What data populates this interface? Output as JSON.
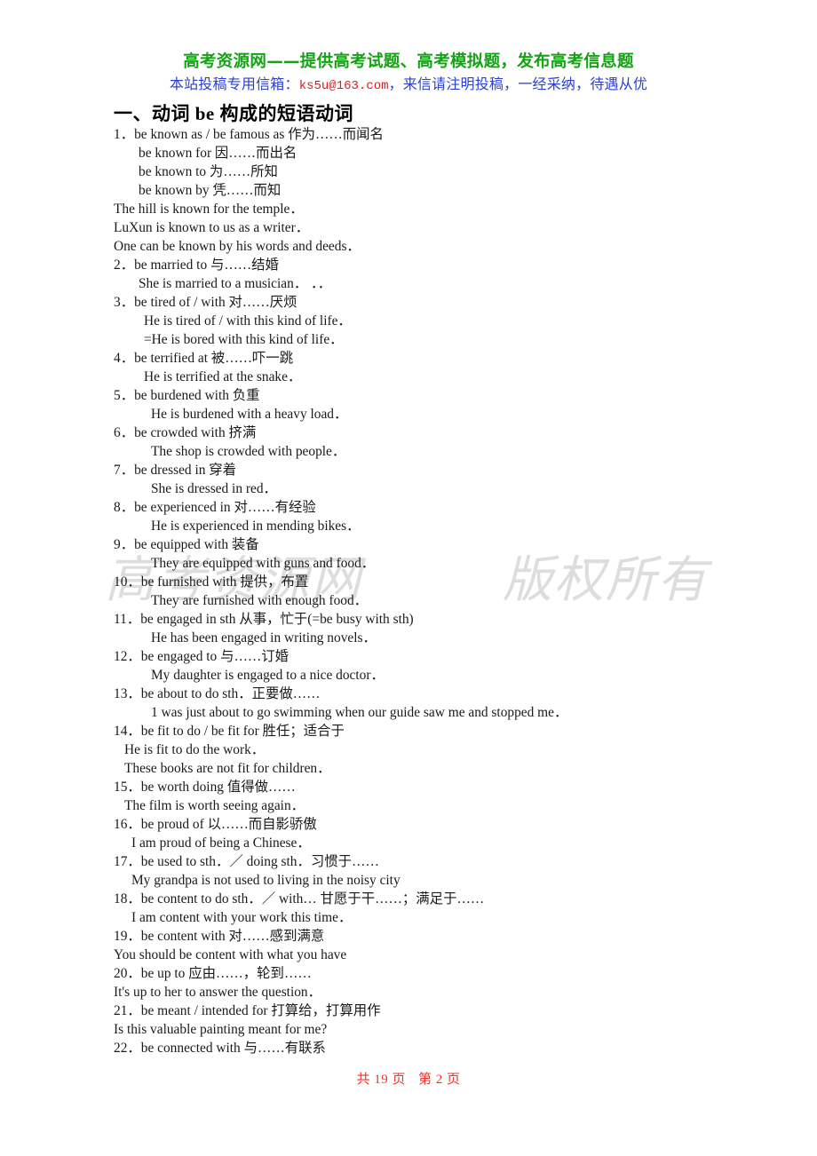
{
  "banner": {
    "title": "高考资源网——提供高考试题、高考模拟题，发布高考信息题",
    "sub_prefix": "本站投稿专用信箱：",
    "email": "ks5u@163.com",
    "sub_suffix": "，来信请注明投稿，一经采纳，待遇从优"
  },
  "heading": "一、动词 be 构成的短语动词",
  "watermark": {
    "left": "高考资源网",
    "right": "版权所有"
  },
  "lines": [
    {
      "indent": "i0",
      "text": "1．be known as / be famous as 作为……而闻名"
    },
    {
      "indent": "i3",
      "text": "be known for 因……而出名"
    },
    {
      "indent": "i3",
      "text": "be known to 为……所知"
    },
    {
      "indent": "i3",
      "text": "be known by 凭……而知"
    },
    {
      "indent": "i0",
      "text": "The hill is known for the temple．"
    },
    {
      "indent": "i0",
      "text": "LuXun is known to us as a writer．"
    },
    {
      "indent": "i0",
      "text": "One can be known by his words and deeds．"
    },
    {
      "indent": "i0",
      "text": "2．be married to 与……结婚"
    },
    {
      "indent": "i3",
      "text": "She is married to a musician．            ．．"
    },
    {
      "indent": "i0",
      "text": "3．be tired of / with 对……厌烦"
    },
    {
      "indent": "i4",
      "text": "He is tired of / with this kind of life．"
    },
    {
      "indent": "i4",
      "text": "=He is bored with this kind of life．"
    },
    {
      "indent": "i0",
      "text": "4．be terrified at 被……吓一跳"
    },
    {
      "indent": "i4",
      "text": "He is terrified at the snake．"
    },
    {
      "indent": "i0",
      "text": "5．be burdened with 负重"
    },
    {
      "indent": "i5",
      "text": "He is burdened with a heavy load．"
    },
    {
      "indent": "i0",
      "text": "6．be crowded with 挤满"
    },
    {
      "indent": "i5",
      "text": "The shop is crowded with people．"
    },
    {
      "indent": "i0",
      "text": "7．be dressed in 穿着"
    },
    {
      "indent": "i5",
      "text": "She is dressed in red．"
    },
    {
      "indent": "i0",
      "text": "8．be experienced in 对……有经验"
    },
    {
      "indent": "i5",
      "text": "He is experienced in mending bikes．"
    },
    {
      "indent": "i0",
      "text": "9．be equipped with 装备"
    },
    {
      "indent": "i5",
      "text": "They are equipped with guns and food．"
    },
    {
      "indent": "i0",
      "text": "10．be furnished with 提供，布置"
    },
    {
      "indent": "i5",
      "text": "They are furnished with enough food．"
    },
    {
      "indent": "i0",
      "text": "11．be engaged in sth 从事，忙于(=be busy with sth)"
    },
    {
      "indent": "i5",
      "text": "He has been engaged in writing novels．"
    },
    {
      "indent": "i0",
      "text": "12．be engaged to 与……订婚"
    },
    {
      "indent": "i5",
      "text": "My daughter is engaged to a nice doctor．"
    },
    {
      "indent": "i0",
      "text": "13．be about to do sth．正要做……"
    },
    {
      "indent": "i5",
      "text": "1 was just about to go swimming when our guide saw me and stopped me．"
    },
    {
      "indent": "i0",
      "text": "14．be fit to do / be fit for 胜任；适合于"
    },
    {
      "indent": "i1",
      "text": "He is fit to do the work．"
    },
    {
      "indent": "i1",
      "text": "These books are not fit for children．"
    },
    {
      "indent": "i0",
      "text": "15．be worth doing 值得做……"
    },
    {
      "indent": "i1",
      "text": "The film is worth seeing again．"
    },
    {
      "indent": "i0",
      "text": "16．be proud of 以……而自影骄傲"
    },
    {
      "indent": "i2",
      "text": "I am proud of being a Chinese．"
    },
    {
      "indent": "i0",
      "text": "17．be used to sth．／ doing sth．习惯于……"
    },
    {
      "indent": "i2",
      "text": "My grandpa is not used to living in the noisy city"
    },
    {
      "indent": "i0",
      "text": "18．be content to do sth．／ with… 甘愿于干……；满足于……"
    },
    {
      "indent": "i2",
      "text": "I am content with your work this time．"
    },
    {
      "indent": "i0",
      "text": "19．be content with 对……感到满意"
    },
    {
      "indent": "i0",
      "text": "You should be content with what you have"
    },
    {
      "indent": "i0",
      "text": "20．be up to 应由……，轮到……"
    },
    {
      "indent": "i0",
      "text": "It's up to her to answer the question．"
    },
    {
      "indent": "i0",
      "text": "21．be meant / intended for 打算给，打算用作"
    },
    {
      "indent": "i0",
      "text": "Is this valuable painting meant for me?"
    },
    {
      "indent": "i0",
      "text": "22．be connected with 与……有联系"
    }
  ],
  "footer": {
    "total": "共 19 页",
    "current": "第 2 页"
  }
}
